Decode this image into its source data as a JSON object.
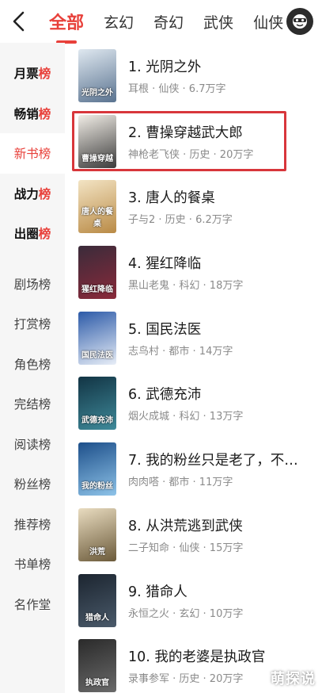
{
  "header": {
    "tabs": [
      {
        "label": "全部",
        "active": true
      },
      {
        "label": "玄幻",
        "active": false
      },
      {
        "label": "奇幻",
        "active": false
      },
      {
        "label": "武侠",
        "active": false
      },
      {
        "label": "仙侠",
        "active": false
      }
    ],
    "back_icon": "chevron-left-icon",
    "avatar_icon": "user-avatar-icon"
  },
  "sidebar": {
    "items": [
      {
        "label": "月票",
        "suffix": "榜",
        "bold": true,
        "active": false
      },
      {
        "label": "畅销",
        "suffix": "榜",
        "bold": true,
        "active": false
      },
      {
        "label": "新书",
        "suffix": "榜",
        "bold": false,
        "active": true
      },
      {
        "label": "战力",
        "suffix": "榜",
        "bold": true,
        "active": false
      },
      {
        "label": "出圈",
        "suffix": "榜",
        "bold": true,
        "active": false
      },
      {
        "label": "剧场榜",
        "suffix": "",
        "bold": false,
        "active": false
      },
      {
        "label": "打赏榜",
        "suffix": "",
        "bold": false,
        "active": false
      },
      {
        "label": "角色榜",
        "suffix": "",
        "bold": false,
        "active": false
      },
      {
        "label": "完结榜",
        "suffix": "",
        "bold": false,
        "active": false
      },
      {
        "label": "阅读榜",
        "suffix": "",
        "bold": false,
        "active": false
      },
      {
        "label": "粉丝榜",
        "suffix": "",
        "bold": false,
        "active": false
      },
      {
        "label": "推荐榜",
        "suffix": "",
        "bold": false,
        "active": false
      },
      {
        "label": "书单榜",
        "suffix": "",
        "bold": false,
        "active": false
      },
      {
        "label": "名作堂",
        "suffix": "",
        "bold": false,
        "active": false
      }
    ]
  },
  "books": [
    {
      "title": "1. 光阴之外",
      "meta": "耳根 · 仙侠 · 6.7万字",
      "cover_colors": [
        "#dfe8f0",
        "#5a7390"
      ],
      "cover_text": "光阴之外"
    },
    {
      "title": "2. 曹操穿越武大郎",
      "meta": "神枪老飞侠 · 历史 · 20万字",
      "cover_colors": [
        "#f1ede6",
        "#3b3b3b"
      ],
      "cover_text": "曹操穿越",
      "highlighted": true
    },
    {
      "title": "3. 唐人的餐桌",
      "meta": "子与2 · 历史 · 6.2万字",
      "cover_colors": [
        "#f3e4c4",
        "#b98a45"
      ],
      "cover_text": "唐人的餐桌"
    },
    {
      "title": "4. 猩红降临",
      "meta": "黑山老鬼 · 科幻 · 18万字",
      "cover_colors": [
        "#3a2b3a",
        "#8a2a3a"
      ],
      "cover_text": "猩红降临"
    },
    {
      "title": "5. 国民法医",
      "meta": "志鸟村 · 都市 · 14万字",
      "cover_colors": [
        "#2c5aa8",
        "#e8eef7"
      ],
      "cover_text": "国民法医"
    },
    {
      "title": "6. 武德充沛",
      "meta": "烟火成城 · 科幻 · 13万字",
      "cover_colors": [
        "#123444",
        "#3f8a9a"
      ],
      "cover_text": "武德充沛"
    },
    {
      "title": "7. 我的粉丝只是老了，不是…",
      "meta": "肉肉嗒 · 都市 · 11万字",
      "cover_colors": [
        "#1d4f8a",
        "#8ec3e8"
      ],
      "cover_text": "我的粉丝"
    },
    {
      "title": "8. 从洪荒逃到武侠",
      "meta": "二子知命 · 仙侠 · 15万字",
      "cover_colors": [
        "#e9dcc0",
        "#6b5a3a"
      ],
      "cover_text": "洪荒"
    },
    {
      "title": "9. 猎命人",
      "meta": "永恒之火 · 玄幻 · 10万字",
      "cover_colors": [
        "#1c2530",
        "#4a5a6a"
      ],
      "cover_text": "猎命人"
    },
    {
      "title": "10. 我的老婆是执政官",
      "meta": "录事参军 · 历史 · 20万字",
      "cover_colors": [
        "#2a2a2a",
        "#6a6a6a"
      ],
      "cover_text": "执政官"
    }
  ],
  "watermark": "萌探说",
  "colors": {
    "accent": "#e8403a",
    "highlight_border": "#d8363b",
    "sidebar_bg": "#f6f6f6"
  }
}
